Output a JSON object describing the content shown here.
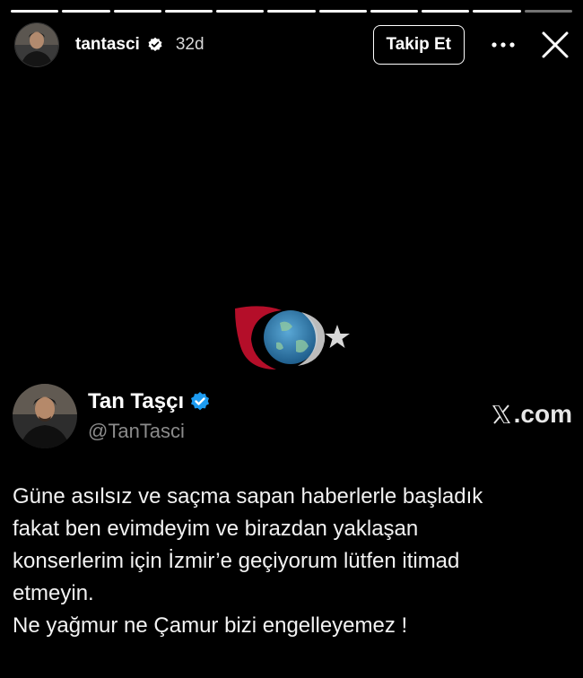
{
  "story": {
    "progress_total": 11,
    "progress_completed": 10
  },
  "header": {
    "username": "tantasci",
    "time_ago": "32d",
    "follow_label": "Takip Et",
    "more_icon": "more-horizontal-icon",
    "close_icon": "close-icon"
  },
  "tweet": {
    "display_name": "Tan Taşçı",
    "handle": "@TanTasci",
    "brand_label": ".com",
    "brand_icon": "x-logo-icon",
    "verified_color": "#1d9bf0",
    "lines": [
      "Güne asılsız ve saçma sapan haberlerle başladık",
      "fakat ben evimdeyim ve birazdan yaklaşan",
      "konserlerim için İzmir’e geçiyorum lütfen itimad",
      "etmeyin.",
      "Ne yağmur ne Çamur bizi engelleyemez !"
    ]
  },
  "watermark": {
    "icon": "globe-crescent-star-watermark",
    "accent": "#c8102e"
  }
}
